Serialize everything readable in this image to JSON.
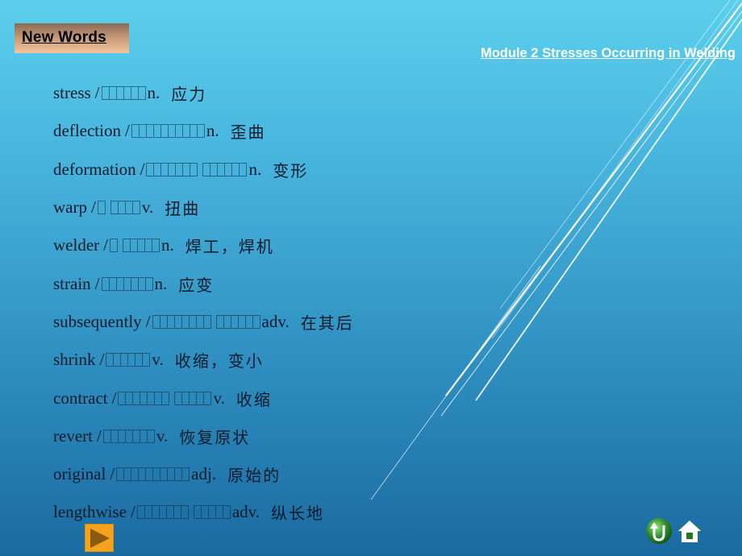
{
  "header": {
    "badge_label": "New Words",
    "module_title": "Module 2  Stresses Occurring in Welding"
  },
  "vocabulary": [
    {
      "word": "stress",
      "ipa_boxes": [
        6
      ],
      "pos": "n.",
      "meaning": "应力"
    },
    {
      "word": "deflection",
      "ipa_boxes": [
        10
      ],
      "pos": "n.",
      "meaning": "歪曲"
    },
    {
      "word": "deformation",
      "ipa_boxes": [
        7,
        6
      ],
      "pos": "n.",
      "meaning": "变形"
    },
    {
      "word": "warp",
      "ipa_boxes": [
        1,
        4
      ],
      "pos": "v.",
      "meaning": "扭曲"
    },
    {
      "word": "welder",
      "ipa_boxes": [
        1,
        5
      ],
      "pos": "n.",
      "meaning": "焊工，焊机"
    },
    {
      "word": "strain",
      "ipa_boxes": [
        7
      ],
      "pos": "n.",
      "meaning": "应变"
    },
    {
      "word": "subsequently",
      "ipa_boxes": [
        8,
        6
      ],
      "pos": "adv.",
      "meaning": "在其后"
    },
    {
      "word": "shrink",
      "ipa_boxes": [
        6
      ],
      "pos": "v.",
      "meaning": "收缩，变小"
    },
    {
      "word": "contract",
      "ipa_boxes": [
        7,
        5
      ],
      "pos": "v.",
      "meaning": "收缩"
    },
    {
      "word": "revert",
      "ipa_boxes": [
        7
      ],
      "pos": "v.",
      "meaning": "恢复原状"
    },
    {
      "word": "original",
      "ipa_boxes": [
        10
      ],
      "pos": "adj.",
      "meaning": "原始的"
    },
    {
      "word": "lengthwise",
      "ipa_boxes": [
        7,
        5
      ],
      "pos": "adv.",
      "meaning": "纵长地"
    }
  ],
  "navigation": {
    "next_icon": "play-arrow-icon",
    "return_icon": "u-turn-return-icon",
    "home_icon": "home-icon"
  },
  "colors": {
    "badge_gradient_top": "#8a6a55",
    "badge_gradient_bottom": "#f4c49a",
    "next_button": "#f6a21c",
    "nav_green": "#2e8b2e",
    "title_text": "#ffffff",
    "body_text": "#0b1a2a"
  }
}
